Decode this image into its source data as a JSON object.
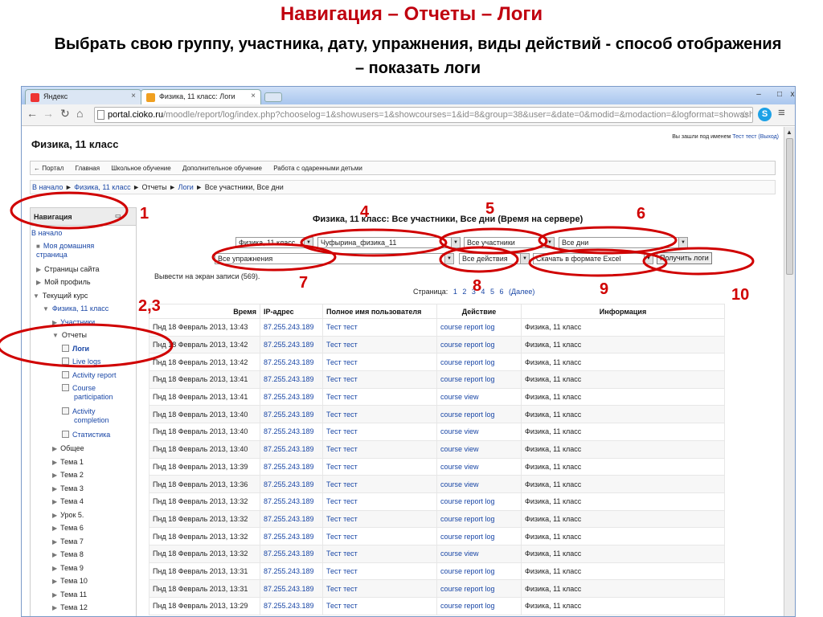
{
  "slide": {
    "title": "Навигация – Отчеты – Логи",
    "subtitle": "Выбрать свою группу, участника, дату, упражнения, виды действий - способ отображения – показать логи"
  },
  "browser": {
    "tabs": [
      {
        "label": "Яндекс",
        "icon": "yandex-icon"
      },
      {
        "label": "Физика, 11 класс: Логи",
        "icon": "moodle-icon"
      }
    ],
    "address_domain": "portal.cioko.ru",
    "address_path": "/moodle/report/log/index.php?chooselog=1&showusers=1&showcourses=1&id=8&group=38&user=&date=0&modid=&modaction=&logformat=showash"
  },
  "page": {
    "course_title": "Физика, 11 класс",
    "login_prefix": "Вы зашли под именем",
    "login_user": "Тест тест",
    "login_logout": "(Выход)",
    "top_menu": [
      "← Портал",
      "Главная",
      "Школьное обучение",
      "Дополнительное обучение",
      "Работа с одаренными детьми"
    ],
    "breadcrumb": {
      "home": "В начало",
      "course": "Физика, 11 класс",
      "reports": "Отчеты",
      "logs": "Логи",
      "current": "Все участники, Все дни"
    }
  },
  "navigation": {
    "header": "Навигация",
    "items": {
      "home": "В начало",
      "my_home": "Моя домашняя страница",
      "site_pages": "Страницы сайта",
      "my_profile": "Мой профиль",
      "current_course": "Текущий курс",
      "course": "Физика, 11 класс",
      "participants": "Участники",
      "reports": "Отчеты",
      "logs": "Логи",
      "live_logs": "Live logs",
      "activity_report": "Activity report",
      "course_participation": "Course participation",
      "activity_completion": "Activity completion",
      "statistics": "Статистика",
      "general": "Общее",
      "topics": [
        "Тема 1",
        "Тема 2",
        "Тема 3",
        "Тема 4",
        "Урок 5.",
        "Тема 6",
        "Тема 7",
        "Тема 8",
        "Тема 9",
        "Тема 10",
        "Тема 11",
        "Тема 12"
      ]
    }
  },
  "report": {
    "title": "Физика, 11 класс: Все участники, Все дни (Время на сервере)",
    "filters": {
      "course": "Физика, 11 класс",
      "group": "Чуфырина_физика_11",
      "participants": "Все участники",
      "days": "Все дни",
      "activities": "Все упражнения",
      "actions": "Все действия",
      "format": "Скачать в формате Excel"
    },
    "get_logs_button": "Получить логи",
    "records": "Вывести на экран записи (569).",
    "pager": {
      "label": "Страница:",
      "pages": [
        "1",
        "2",
        "3",
        "4",
        "5",
        "6"
      ],
      "next": "(Далее)"
    },
    "columns": [
      "Время",
      "IP-адрес",
      "Полное имя пользователя",
      "Действие",
      "Информация"
    ],
    "rows": [
      [
        "Пнд 18 Февраль 2013, 13:43",
        "87.255.243.189",
        "Тест тест",
        "course report log",
        "Физика, 11 класс"
      ],
      [
        "Пнд 18 Февраль 2013, 13:42",
        "87.255.243.189",
        "Тест тест",
        "course report log",
        "Физика, 11 класс"
      ],
      [
        "Пнд 18 Февраль 2013, 13:42",
        "87.255.243.189",
        "Тест тест",
        "course report log",
        "Физика, 11 класс"
      ],
      [
        "Пнд 18 Февраль 2013, 13:41",
        "87.255.243.189",
        "Тест тест",
        "course report log",
        "Физика, 11 класс"
      ],
      [
        "Пнд 18 Февраль 2013, 13:41",
        "87.255.243.189",
        "Тест тест",
        "course view",
        "Физика, 11 класс"
      ],
      [
        "Пнд 18 Февраль 2013, 13:40",
        "87.255.243.189",
        "Тест тест",
        "course report log",
        "Физика, 11 класс"
      ],
      [
        "Пнд 18 Февраль 2013, 13:40",
        "87.255.243.189",
        "Тест тест",
        "course view",
        "Физика, 11 класс"
      ],
      [
        "Пнд 18 Февраль 2013, 13:40",
        "87.255.243.189",
        "Тест тест",
        "course view",
        "Физика, 11 класс"
      ],
      [
        "Пнд 18 Февраль 2013, 13:39",
        "87.255.243.189",
        "Тест тест",
        "course view",
        "Физика, 11 класс"
      ],
      [
        "Пнд 18 Февраль 2013, 13:36",
        "87.255.243.189",
        "Тест тест",
        "course view",
        "Физика, 11 класс"
      ],
      [
        "Пнд 18 Февраль 2013, 13:32",
        "87.255.243.189",
        "Тест тест",
        "course report log",
        "Физика, 11 класс"
      ],
      [
        "Пнд 18 Февраль 2013, 13:32",
        "87.255.243.189",
        "Тест тест",
        "course report log",
        "Физика, 11 класс"
      ],
      [
        "Пнд 18 Февраль 2013, 13:32",
        "87.255.243.189",
        "Тест тест",
        "course report log",
        "Физика, 11 класс"
      ],
      [
        "Пнд 18 Февраль 2013, 13:32",
        "87.255.243.189",
        "Тест тест",
        "course view",
        "Физика, 11 класс"
      ],
      [
        "Пнд 18 Февраль 2013, 13:31",
        "87.255.243.189",
        "Тест тест",
        "course report log",
        "Физика, 11 класс"
      ],
      [
        "Пнд 18 Февраль 2013, 13:31",
        "87.255.243.189",
        "Тест тест",
        "course report log",
        "Физика, 11 класс"
      ],
      [
        "Пнд 18 Февраль 2013, 13:29",
        "87.255.243.189",
        "Тест тест",
        "course report log",
        "Физика, 11 класс"
      ]
    ]
  },
  "annotations": {
    "color": "#d00000",
    "labels": [
      "1",
      "2,3",
      "4",
      "5",
      "6",
      "7",
      "8",
      "9",
      "10"
    ]
  }
}
